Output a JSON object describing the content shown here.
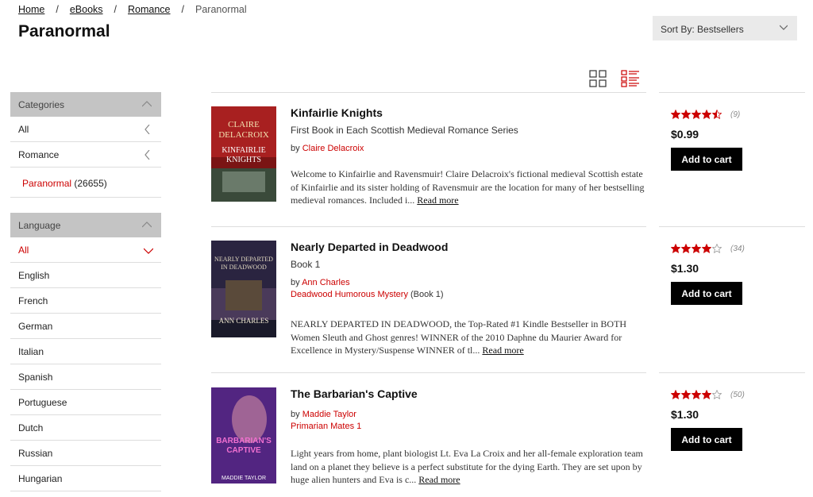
{
  "breadcrumb": {
    "items": [
      "Home",
      "eBooks",
      "Romance"
    ],
    "current": "Paranormal",
    "separator": "/"
  },
  "page_title": "Paranormal",
  "sort": {
    "label": "Sort By: Bestsellers"
  },
  "sidebar": {
    "categories": {
      "header": "Categories",
      "items": [
        "All",
        "Romance"
      ],
      "selected": {
        "label": "Paranormal",
        "count": "(26655)"
      }
    },
    "language": {
      "header": "Language",
      "items": [
        "All",
        "English",
        "French",
        "German",
        "Italian",
        "Spanish",
        "Portuguese",
        "Dutch",
        "Russian",
        "Hungarian"
      ]
    }
  },
  "products": [
    {
      "title": "Kinfairlie Knights",
      "subtitle": "First Book in Each Scottish Medieval Romance Series",
      "by": "by",
      "author": "Claire Delacroix",
      "series": "",
      "series_num": "",
      "description": "Welcome to Kinfairlie and Ravensmuir! Claire Delacroix's fictional medieval Scottish estate of Kinfairlie and its sister holding of Ravensmuir are the location for many of her bestselling medieval romances. Included i...",
      "read_more": "Read more",
      "rating": 4.5,
      "rating_count": "(9)",
      "price": "$0.99",
      "cart": "Add to cart",
      "cover": {
        "author_text": "CLAIRE DELACROIX",
        "title_text": "KINFAIRLIE KNIGHTS",
        "bg": "#8b1a1a"
      }
    },
    {
      "title": "Nearly Departed in Deadwood",
      "subtitle": "Book 1",
      "by": "by",
      "author": "Ann Charles",
      "series": "Deadwood Humorous Mystery",
      "series_num": "(Book 1)",
      "description": "NEARLY DEPARTED IN DEADWOOD, the Top-Rated #1 Kindle Bestseller in BOTH Women Sleuth and Ghost genres! WINNER of the 2010 Daphne du Maurier Award for Excellence in Mystery/Suspense WINNER of tl...",
      "read_more": "Read more",
      "rating": 4,
      "rating_count": "(34)",
      "price": "$1.30",
      "cart": "Add to cart",
      "cover": {
        "author_text": "ANN CHARLES",
        "title_text": "NEARLY DEPARTED IN DEADWOOD",
        "bg": "#2a2540"
      }
    },
    {
      "title": "The Barbarian's Captive",
      "subtitle": "",
      "by": "by",
      "author": "Maddie Taylor",
      "series": "Primarian Mates 1",
      "series_num": "",
      "description": "Light years from home, plant biologist Lt. Eva La Croix and her all-female exploration team land on a planet they believe is a perfect substitute for the dying Earth.  They are set upon by huge alien hunters and Eva is c...",
      "read_more": "Read more",
      "rating": 4,
      "rating_count": "(50)",
      "price": "$1.30",
      "cart": "Add to cart",
      "cover": {
        "author_text": "MADDIE TAYLOR",
        "title_text": "BARBARIAN'S CAPTIVE",
        "bg": "#5a2a7a"
      }
    }
  ],
  "colors": {
    "accent": "#cc0000",
    "star": "#cc0000",
    "button": "#000000"
  }
}
